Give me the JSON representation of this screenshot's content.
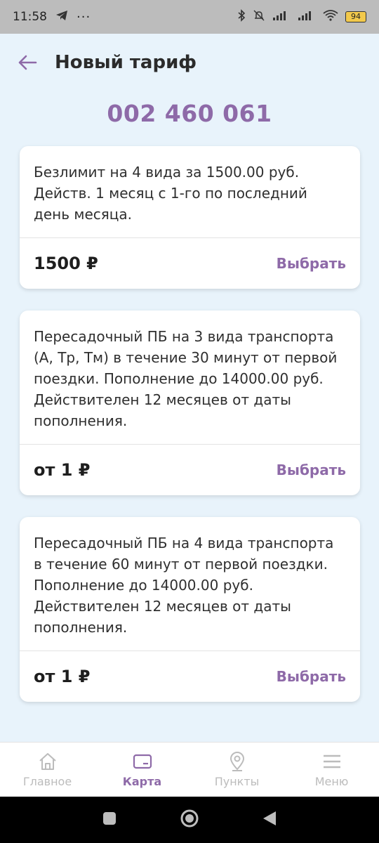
{
  "status_bar": {
    "time": "11:58",
    "battery": "94"
  },
  "header": {
    "title": "Новый тариф"
  },
  "card_number": "002 460 061",
  "tariffs": [
    {
      "description": "Безлимит на 4 вида за 1500.00 руб. Действ. 1 месяц с 1-го по последний день месяца.",
      "price": "1500 ₽",
      "select_label": "Выбрать"
    },
    {
      "description": "Пересадочный ПБ на 3 вида транспорта (А, Тр, Тм) в течение 30 минут от первой поездки. Пополнение до 14000.00 руб. Действителен 12 месяцев от даты пополнения.",
      "price": "от 1 ₽",
      "select_label": "Выбрать"
    },
    {
      "description": "Пересадочный ПБ на 4 вида транспорта в течение 60 минут от первой поездки. Пополнение до 14000.00 руб. Действителен 12 месяцев от даты пополнения.",
      "price": "от 1 ₽",
      "select_label": "Выбрать"
    }
  ],
  "bottom_nav": [
    {
      "label": "Главное",
      "icon": "home-icon",
      "active": false
    },
    {
      "label": "Карта",
      "icon": "card-icon",
      "active": true
    },
    {
      "label": "Пункты",
      "icon": "location-pin-icon",
      "active": false
    },
    {
      "label": "Меню",
      "icon": "menu-icon",
      "active": false
    }
  ],
  "colors": {
    "accent": "#8e6aa8",
    "background": "#e8f3fb",
    "inactive": "#bcbcbc"
  }
}
